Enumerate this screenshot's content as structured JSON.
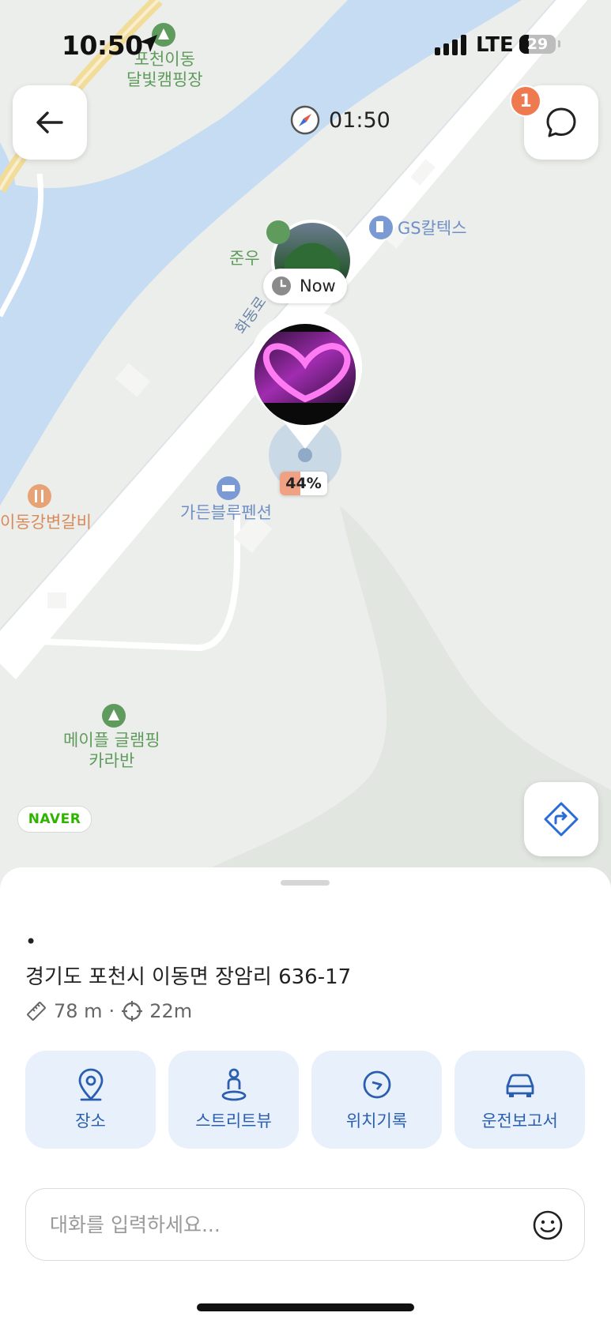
{
  "status_bar": {
    "time": "10:50",
    "network": "LTE",
    "battery": "29"
  },
  "header": {
    "back_label": "back",
    "timer": "01:50",
    "notification_count": "1"
  },
  "map": {
    "pois": [
      {
        "name": "포천이동\n달빛캠핑장",
        "kind": "camping"
      },
      {
        "name": "GS칼텍스",
        "kind": "gas"
      },
      {
        "name": "준우",
        "kind": "place"
      },
      {
        "name": "이동강변갈비",
        "kind": "restaurant"
      },
      {
        "name": "가든블루펜션",
        "kind": "lodging"
      },
      {
        "name": "메이플 글램핑\n카라반",
        "kind": "camping"
      }
    ],
    "road_label": "화동로",
    "provider": "NAVER",
    "now_label": "Now",
    "battery_percent_label": "44%",
    "battery_percent": 44
  },
  "sheet": {
    "name_dot": "•",
    "address": "경기도 포천시 이동면 장암리 636-17",
    "distance": "78 m",
    "separator": "·",
    "accuracy": "22m",
    "actions": [
      {
        "label": "장소",
        "icon": "pin-icon"
      },
      {
        "label": "스트리트뷰",
        "icon": "street-view-icon"
      },
      {
        "label": "위치기록",
        "icon": "history-icon"
      },
      {
        "label": "운전보고서",
        "icon": "car-icon"
      }
    ],
    "chat_placeholder": "대화를 입력하세요..."
  },
  "colors": {
    "accent": "#2a5fb0",
    "action_bg": "#e8f0fc",
    "badge": "#ef7a4f",
    "river": "#c6dcf2"
  }
}
